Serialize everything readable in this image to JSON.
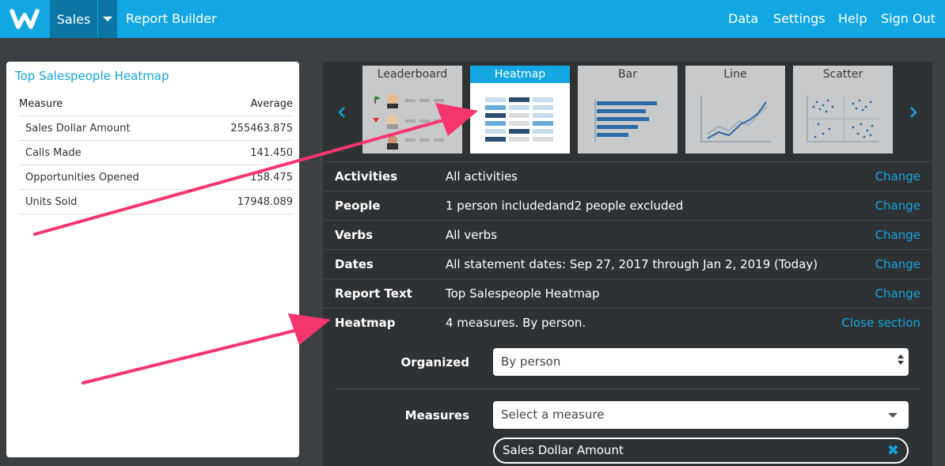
{
  "header": {
    "app_name": "Sales",
    "breadcrumb": "Report Builder",
    "nav": [
      "Data",
      "Settings",
      "Help",
      "Sign Out"
    ],
    "brand_color": "#12a7e2"
  },
  "report": {
    "title": "Top Salespeople Heatmap",
    "columns": [
      "Measure",
      "Average"
    ],
    "rows": [
      {
        "measure": "Sales Dollar Amount",
        "average": "255463.875"
      },
      {
        "measure": "Calls Made",
        "average": "141.450"
      },
      {
        "measure": "Opportunities Opened",
        "average": "158.475"
      },
      {
        "measure": "Units Sold",
        "average": "17948.089"
      }
    ]
  },
  "chart_types": {
    "tiles": [
      "Leaderboard",
      "Heatmap",
      "Bar",
      "Line",
      "Scatter"
    ],
    "selected": "Heatmap"
  },
  "sections": [
    {
      "label": "Activities",
      "value": "All activities",
      "action": "Change"
    },
    {
      "label": "People",
      "value": "1 person includedand2 people excluded",
      "action": "Change"
    },
    {
      "label": "Verbs",
      "value": "All verbs",
      "action": "Change"
    },
    {
      "label": "Dates",
      "value": "All statement dates: Sep 27, 2017 through Jan 2, 2019 (Today)",
      "action": "Change"
    },
    {
      "label": "Report Text",
      "value": "Top Salespeople Heatmap",
      "action": "Change"
    },
    {
      "label": "Heatmap",
      "value": "4 measures. By person.",
      "action": "Close section"
    }
  ],
  "heatmap_form": {
    "organized_label": "Organized",
    "organized_value": "By person",
    "measures_label": "Measures",
    "measures_placeholder": "Select a measure",
    "selected_measures": [
      "Sales Dollar Amount"
    ]
  },
  "annotation_color": "#f7356f"
}
